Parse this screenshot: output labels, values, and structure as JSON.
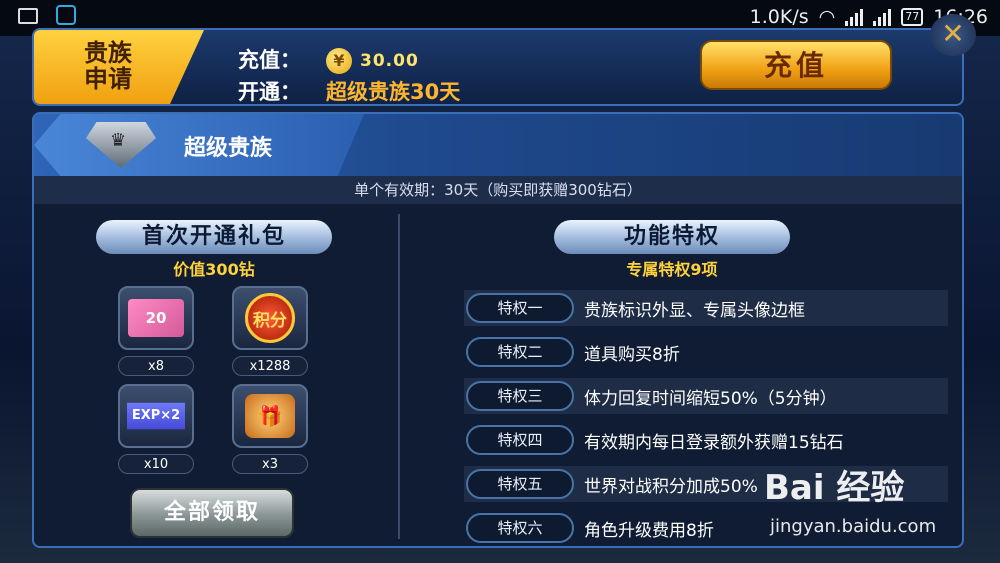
{
  "status_bar": {
    "speed": "1.0K/s",
    "battery": "77",
    "time": "16:26"
  },
  "header": {
    "noble_apply_label": "贵族\n申请",
    "noble_line1": "贵族",
    "noble_line2": "申请",
    "recharge_label": "充值：",
    "price": "30.00",
    "open_label": "开通：",
    "plan": "超级贵族30天",
    "recharge_button": "充值"
  },
  "banner": {
    "title": "超级贵族",
    "validity": "单个有效期：30天（购买即获赠300钻石）"
  },
  "gift_pack": {
    "title": "首次开通礼包",
    "value": "价值300钻",
    "items": [
      {
        "icon": "ticket-icon",
        "art": "20",
        "qty": "x8"
      },
      {
        "icon": "points-icon",
        "art": "积分",
        "qty": "x1288"
      },
      {
        "icon": "exp-card-icon",
        "art": "EXP×2",
        "qty": "x10"
      },
      {
        "icon": "gift-box-icon",
        "art": "",
        "qty": "x3"
      }
    ],
    "claim_button": "全部领取"
  },
  "privileges": {
    "title": "功能特权",
    "subtitle": "专属特权9项",
    "items": [
      {
        "badge": "特权一",
        "text": "贵族标识外显、专属头像边框"
      },
      {
        "badge": "特权二",
        "text": "道具购买8折"
      },
      {
        "badge": "特权三",
        "text": "体力回复时间缩短50%（5分钟）"
      },
      {
        "badge": "特权四",
        "text": "有效期内每日登录额外获赠15钻石"
      },
      {
        "badge": "特权五",
        "text": "世界对战积分加成50%"
      },
      {
        "badge": "特权六",
        "text": "角色升级费用8折"
      }
    ]
  },
  "watermark": {
    "logo": "Bai 经验",
    "url": "jingyan.baidu.com"
  }
}
